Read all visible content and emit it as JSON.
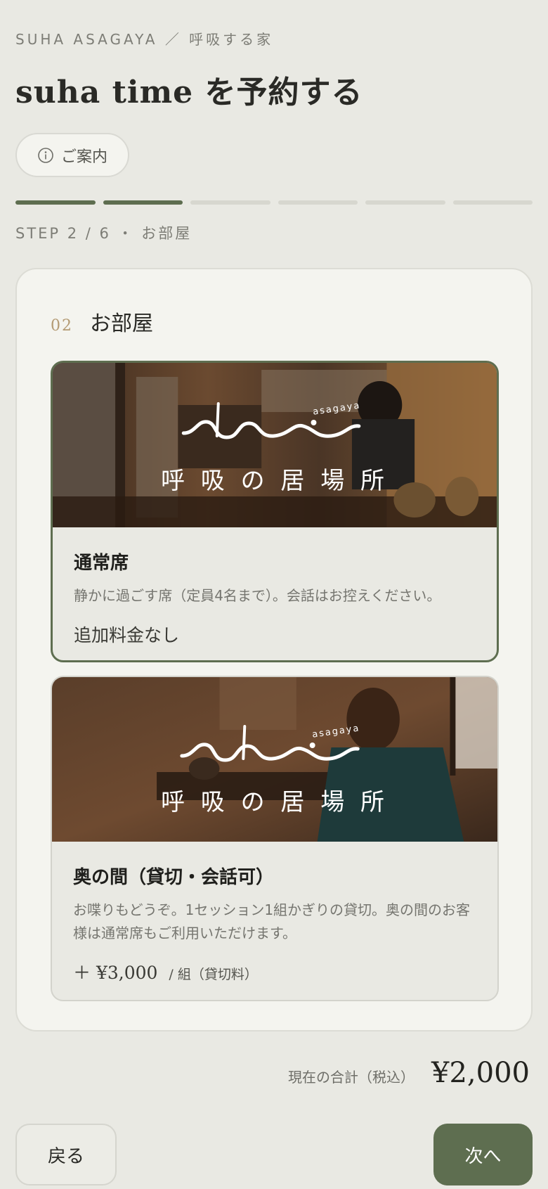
{
  "header": {
    "breadcrumb": "SUHA ASAGAYA ／ 呼吸する家",
    "title": "suha time を予約する",
    "guide_label": "ご案内"
  },
  "progress": {
    "current": 2,
    "total": 6
  },
  "step_label": "STEP 2 / 6 ・ お部屋",
  "section": {
    "number": "02",
    "title": "お部屋"
  },
  "rooms": [
    {
      "selected": true,
      "logo_sub": "asagaya",
      "logo_caption": "呼 吸 の 居 場 所",
      "name": "通常席",
      "description": "静かに過ごす席（定員4名まで）。会話はお控えください。",
      "price": "追加料金なし"
    },
    {
      "selected": false,
      "logo_sub": "asagaya",
      "logo_caption": "呼 吸 の 居 場 所",
      "name": "奥の間（貸切・会話可）",
      "description": "お喋りもどうぞ。1セッション1組かぎりの貸切。奥の間のお客様は通常席もご利用いただけます。",
      "price_prefix": "＋",
      "price_amount": "¥3,000",
      "price_unit": "/ 組（貸切料）"
    }
  ],
  "footer": {
    "total_label": "現在の合計（税込）",
    "total_value": "¥2,000",
    "back_label": "戻る",
    "next_label": "次へ"
  },
  "colors": {
    "accent": "#5e6e50",
    "background": "#e9e9e3",
    "card": "#f4f4ef",
    "number_gold": "#b39a73"
  }
}
